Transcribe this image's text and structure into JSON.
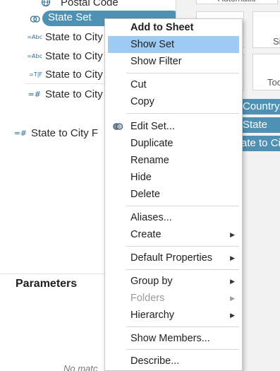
{
  "data_pane": {
    "postal_code": "Postal Code",
    "state_set": "State Set",
    "fields": [
      {
        "icon": "=Abc",
        "label": "State to City"
      },
      {
        "icon": "=Abc",
        "label": "State to City"
      },
      {
        "icon": "=T|F",
        "label": "State to City"
      },
      {
        "icon": "=#",
        "label": "State to City"
      }
    ],
    "measure": {
      "icon": "=#",
      "label": "State to City F"
    },
    "parameters_title": "Parameters",
    "no_match": "No matc"
  },
  "right_area": {
    "marks_type": "Automatic",
    "card_label_1": "Si",
    "card_label_2": "Too",
    "pills": [
      "Country,",
      "State",
      "ate to Cit"
    ]
  },
  "context_menu": {
    "add_to_sheet": "Add to Sheet",
    "show_set": "Show Set",
    "show_filter": "Show Filter",
    "cut": "Cut",
    "copy": "Copy",
    "edit_set": "Edit Set...",
    "duplicate": "Duplicate",
    "rename": "Rename",
    "hide": "Hide",
    "delete": "Delete",
    "aliases": "Aliases...",
    "create": "Create",
    "default_properties": "Default Properties",
    "group_by": "Group by",
    "folders": "Folders",
    "hierarchy": "Hierarchy",
    "show_members": "Show Members...",
    "describe": "Describe..."
  },
  "colors": {
    "pill_blue": "#4f91b5",
    "menu_highlight": "#9ecbf3",
    "field_icon": "#2e6f94"
  }
}
